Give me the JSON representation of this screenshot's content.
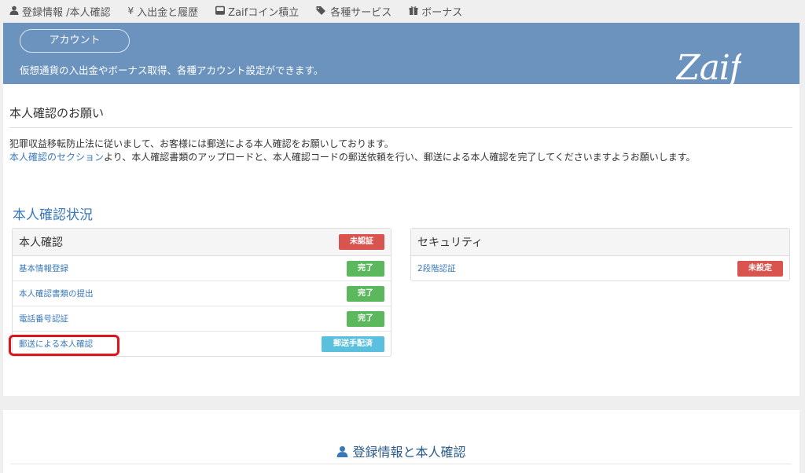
{
  "nav": {
    "items": [
      {
        "icon": "person-icon",
        "label": "登録情報 /本人確認"
      },
      {
        "icon": "yen-icon",
        "label": "入出金と履歴"
      },
      {
        "icon": "inbox-icon",
        "label": "Zaifコイン積立"
      },
      {
        "icon": "tags-icon",
        "label": "各種サービス"
      },
      {
        "icon": "gift-icon",
        "label": "ボーナス"
      }
    ]
  },
  "banner": {
    "account_button": "アカウント",
    "description": "仮想通貨の入出金やボーナス取得、各種アカウント設定ができます。",
    "logo": "Zaif",
    "bg_color": "#6b93be"
  },
  "notice": {
    "title": "本人確認のお願い",
    "line1": "犯罪収益移転防止法に従いまして、お客様には郵送による本人確認をお願いしております。",
    "line2_link": "本人確認のセクション",
    "line2_rest": "より、本人確認書類のアップロードと、本人確認コードの郵送依頼を行い、郵送による本人確認を完了してくださいますようお願いします。"
  },
  "status": {
    "title": "本人確認状況",
    "identity_panel": {
      "title": "本人確認",
      "badge": "未認証",
      "rows": [
        {
          "label": "基本情報登録",
          "badge": "完了"
        },
        {
          "label": "本人確認書類の提出",
          "badge": "完了"
        },
        {
          "label": "電話番号認証",
          "badge": "完了"
        },
        {
          "label": "郵送による本人確認",
          "badge": "郵送手配済"
        }
      ]
    },
    "security_panel": {
      "title": "セキュリティ",
      "rows": [
        {
          "label": "2段階認証",
          "badge": "未設定"
        }
      ]
    }
  },
  "footer_section": {
    "title": "登録情報と本人確認"
  }
}
